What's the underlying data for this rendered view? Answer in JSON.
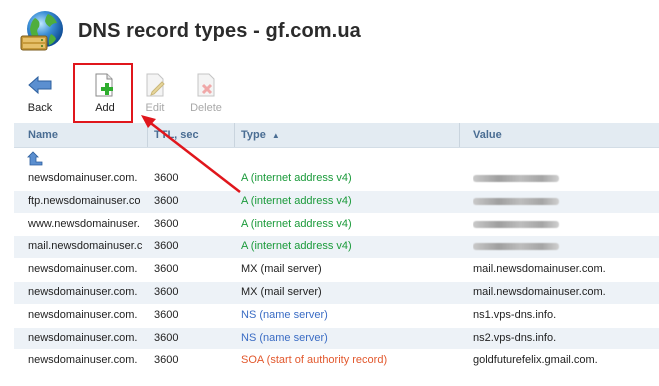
{
  "header": {
    "title": "DNS record types - gf.com.ua",
    "icon": "globe-server-icon"
  },
  "toolbar": {
    "back_label": "Back",
    "add_label": "Add",
    "edit_label": "Edit",
    "delete_label": "Delete"
  },
  "table": {
    "columns": {
      "name": "Name",
      "ttl": "TTL, sec",
      "type": "Type",
      "value": "Value"
    },
    "sort_indicator": "▲",
    "rows": [
      {
        "name": "newsdomainuser.com.",
        "ttl": "3600",
        "type": "A (internet address v4)",
        "type_class": "a",
        "value": "",
        "value_blurred": true
      },
      {
        "name": "ftp.newsdomainuser.co",
        "ttl": "3600",
        "type": "A (internet address v4)",
        "type_class": "a",
        "value": "",
        "value_blurred": true
      },
      {
        "name": "www.newsdomainuser.",
        "ttl": "3600",
        "type": "A (internet address v4)",
        "type_class": "a",
        "value": "",
        "value_blurred": true
      },
      {
        "name": "mail.newsdomainuser.c",
        "ttl": "3600",
        "type": "A (internet address v4)",
        "type_class": "a",
        "value": "",
        "value_blurred": true
      },
      {
        "name": "newsdomainuser.com.",
        "ttl": "3600",
        "type": "MX (mail server)",
        "type_class": "mx",
        "value": "mail.newsdomainuser.com."
      },
      {
        "name": "newsdomainuser.com.",
        "ttl": "3600",
        "type": "MX (mail server)",
        "type_class": "mx",
        "value": "mail.newsdomainuser.com."
      },
      {
        "name": "newsdomainuser.com.",
        "ttl": "3600",
        "type": "NS (name server)",
        "type_class": "ns",
        "value": "ns1.vps-dns.info."
      },
      {
        "name": "newsdomainuser.com.",
        "ttl": "3600",
        "type": "NS (name server)",
        "type_class": "ns",
        "value": "ns2.vps-dns.info."
      },
      {
        "name": "newsdomainuser.com.",
        "ttl": "3600",
        "type": "SOA (start of authority record)",
        "type_class": "soa",
        "value": "goldfuturefelix.gmail.com."
      }
    ]
  },
  "colors": {
    "type_a": "#1a9a3a",
    "type_ns": "#3a6cc4",
    "type_soa": "#e2582d",
    "highlight": "#e0161c",
    "header_bg": "#e3ebf2"
  }
}
